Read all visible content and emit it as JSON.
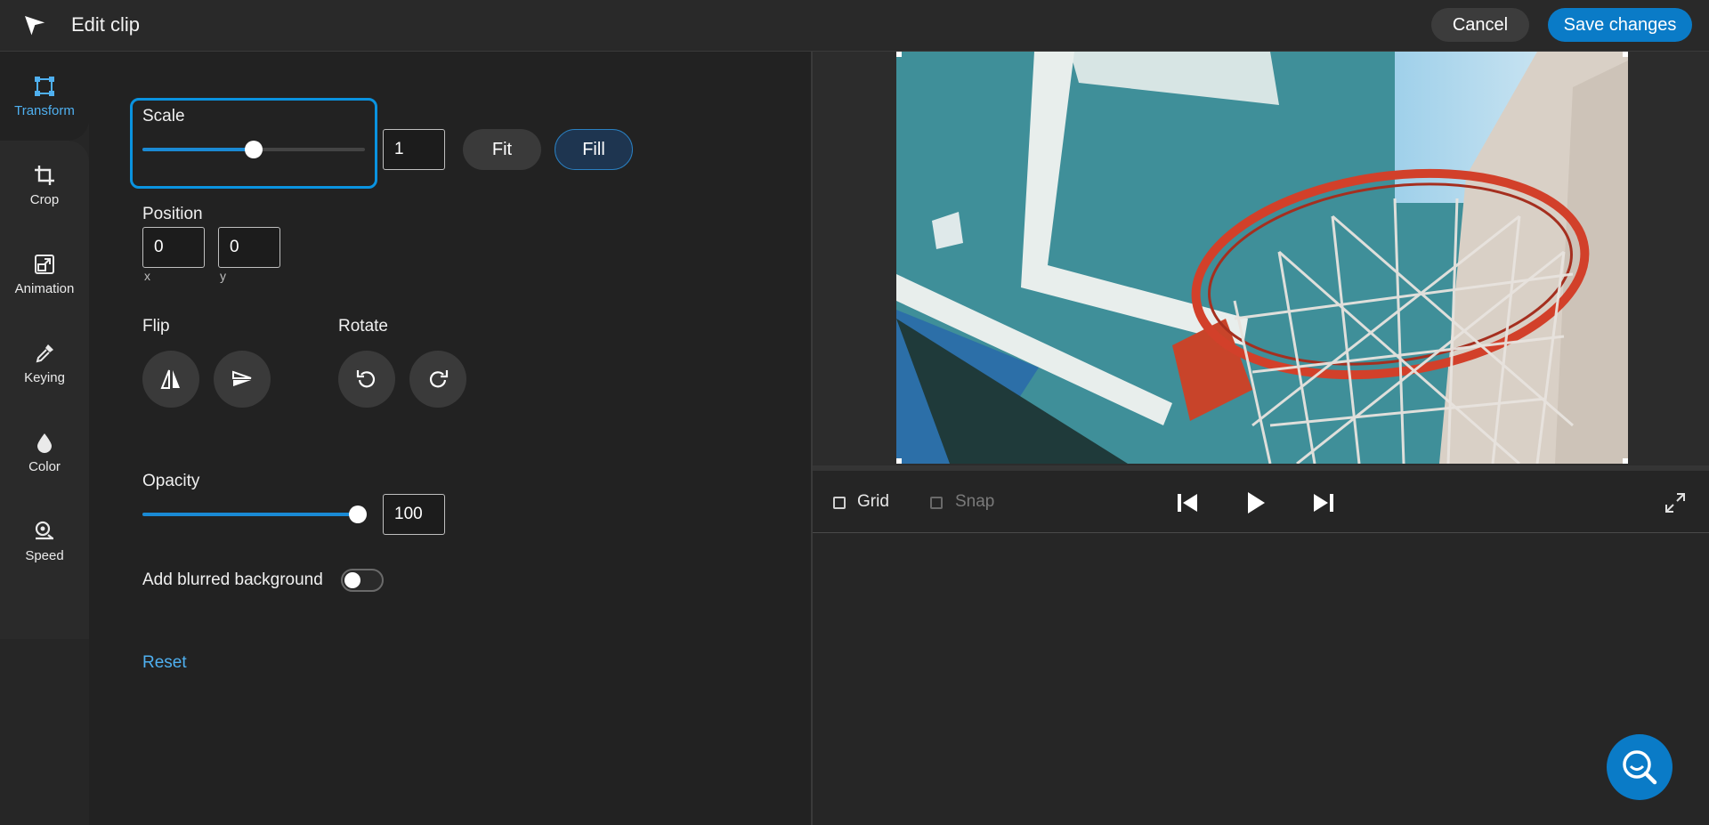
{
  "header": {
    "title": "Edit clip",
    "cancel_label": "Cancel",
    "save_label": "Save changes"
  },
  "rail": {
    "items": [
      {
        "label": "Transform",
        "icon": "transform-icon",
        "active": true
      },
      {
        "label": "Crop",
        "icon": "crop-icon"
      },
      {
        "label": "Animation",
        "icon": "animation-icon"
      },
      {
        "label": "Keying",
        "icon": "eyedropper-icon"
      },
      {
        "label": "Color",
        "icon": "droplet-icon"
      },
      {
        "label": "Speed",
        "icon": "speedometer-icon"
      }
    ]
  },
  "transform": {
    "scale": {
      "label": "Scale",
      "value": "1",
      "slider_fraction": 0.5,
      "fit_label": "Fit",
      "fill_label": "Fill"
    },
    "position": {
      "label": "Position",
      "x": "0",
      "y": "0",
      "x_label": "x",
      "y_label": "y"
    },
    "flip": {
      "label": "Flip"
    },
    "rotate": {
      "label": "Rotate"
    },
    "opacity": {
      "label": "Opacity",
      "value": "100",
      "slider_fraction": 1.0
    },
    "blur": {
      "label": "Add blurred background",
      "enabled": false
    },
    "reset_label": "Reset"
  },
  "preview": {
    "grid_label": "Grid",
    "snap_label": "Snap"
  },
  "colors": {
    "accent": "#0a7bc7",
    "accent_text": "#4fb0f0",
    "background": "#222222"
  }
}
